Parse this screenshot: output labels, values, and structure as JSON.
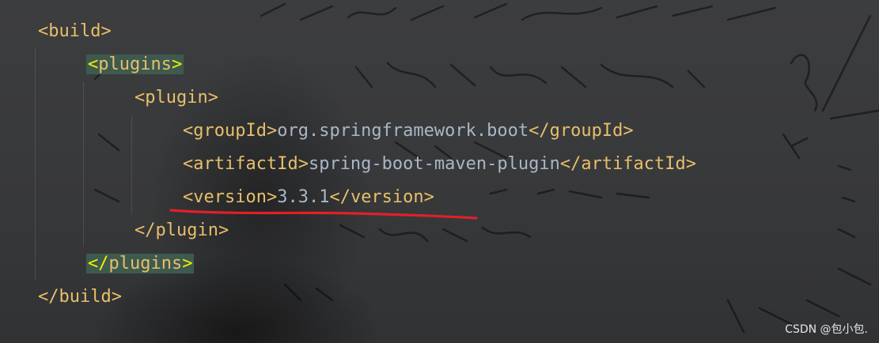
{
  "code": {
    "lines": [
      {
        "indent": 0,
        "open": "<",
        "name": "build",
        "close": ">",
        "content": "",
        "end_tag": "",
        "highlight": false
      },
      {
        "indent": 1,
        "open": "<",
        "name": "plugins",
        "close": ">",
        "content": "",
        "end_tag": "",
        "highlight": true
      },
      {
        "indent": 2,
        "open": "<",
        "name": "plugin",
        "close": ">",
        "content": "",
        "end_tag": "",
        "highlight": false
      },
      {
        "indent": 3,
        "open": "<",
        "name": "groupId",
        "close": ">",
        "content": "org.springframework.boot",
        "end_tag": "</groupId>",
        "highlight": false
      },
      {
        "indent": 3,
        "open": "<",
        "name": "artifactId",
        "close": ">",
        "content": "spring-boot-maven-plugin",
        "end_tag": "</artifactId>",
        "highlight": false
      },
      {
        "indent": 3,
        "open": "<",
        "name": "version",
        "close": ">",
        "content": "3.3.1",
        "end_tag": "</version>",
        "highlight": false
      },
      {
        "indent": 2,
        "open": "</",
        "name": "plugin",
        "close": ">",
        "content": "",
        "end_tag": "",
        "highlight": false
      },
      {
        "indent": 1,
        "open": "</",
        "name": "plugins",
        "close": ">",
        "content": "",
        "end_tag": "",
        "highlight": true
      },
      {
        "indent": 0,
        "open": "</",
        "name": "build",
        "close": ">",
        "content": "",
        "end_tag": "",
        "highlight": false
      }
    ]
  },
  "annotation": {
    "underline_color": "#e0202a",
    "underlined_line": 5
  },
  "watermark": "CSDN @包小包."
}
